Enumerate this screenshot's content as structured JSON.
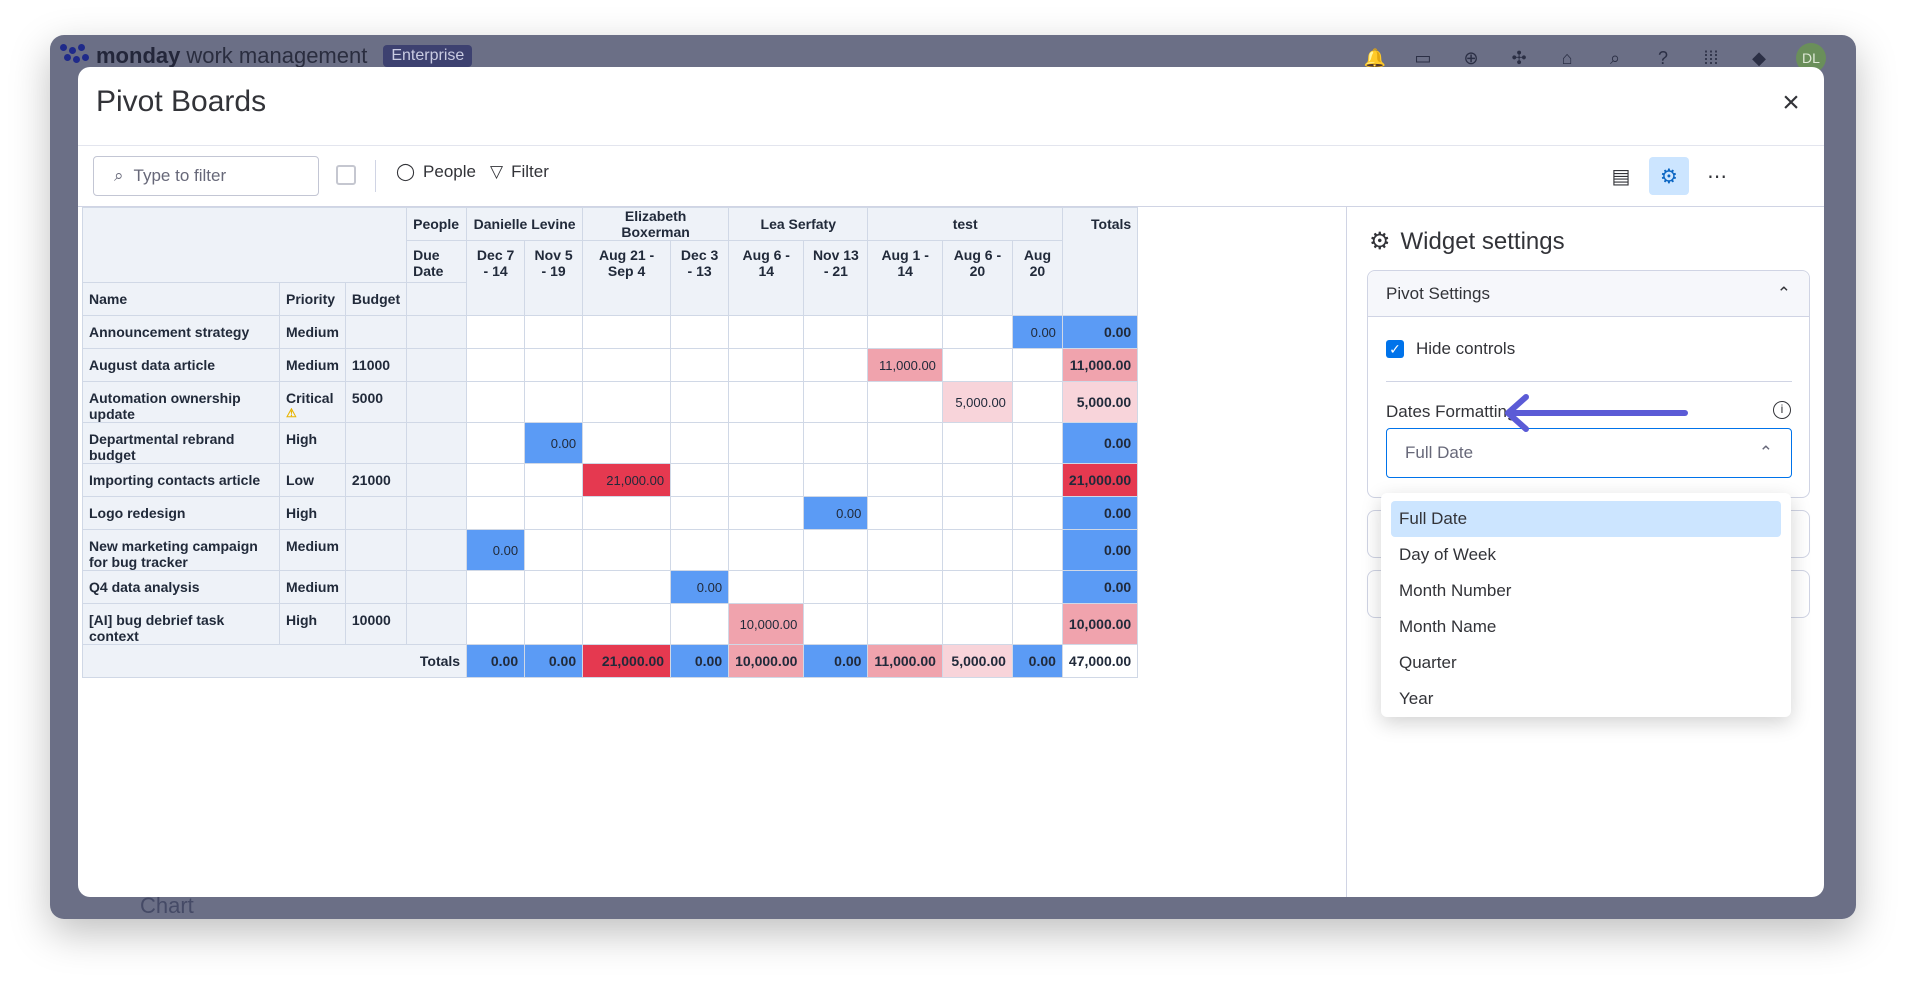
{
  "app": {
    "brand_bold": "monday",
    "brand_rest": "work management",
    "plan_badge": "Enterprise",
    "user_initials": "DL",
    "background_section_label": "Chart"
  },
  "modal": {
    "title": "Pivot Boards",
    "close_icon": "close-icon"
  },
  "toolbar": {
    "filter_placeholder": "Type to filter",
    "people_label": "People",
    "filter_label": "Filter"
  },
  "pivot": {
    "row_header_people": "People",
    "row_header_due": "Due Date",
    "col_name": "Name",
    "col_priority": "Priority",
    "col_budget": "Budget",
    "totals_label": "Totals",
    "groups": [
      {
        "name": "Danielle Levine"
      },
      {
        "name": "Elizabeth Boxerman"
      },
      {
        "name": "Lea Serfaty"
      },
      {
        "name": "test"
      }
    ],
    "date_cols": [
      "Dec 7 - 14",
      "Nov 5 - 19",
      "Aug 21 - Sep 4",
      "Dec 3 - 13",
      "Aug 6 - 14",
      "Nov 13 - 21",
      "Aug 1 - 14",
      "Aug 6 - 20",
      "Aug 20"
    ],
    "rows": [
      {
        "name": "Announcement strategy",
        "priority": "Medium",
        "budget": "",
        "cells": [
          "",
          "",
          "",
          "",
          "",
          "",
          "",
          "",
          "0.00"
        ],
        "total": "0.00"
      },
      {
        "name": "August data article",
        "priority": "Medium",
        "budget": "11000",
        "cells": [
          "",
          "",
          "",
          "",
          "",
          "",
          "11,000.00",
          "",
          ""
        ],
        "total": "11,000.00"
      },
      {
        "name": "Automation ownership update",
        "priority": "Critical",
        "priority_icon": "warning-icon",
        "budget": "5000",
        "cells": [
          "",
          "",
          "",
          "",
          "",
          "",
          "",
          "5,000.00",
          ""
        ],
        "total": "5,000.00"
      },
      {
        "name": "Departmental rebrand budget",
        "priority": "High",
        "budget": "",
        "cells": [
          "",
          "0.00",
          "",
          "",
          "",
          "",
          "",
          "",
          ""
        ],
        "total": "0.00"
      },
      {
        "name": "Importing contacts article",
        "priority": "Low",
        "budget": "21000",
        "cells": [
          "",
          "",
          "21,000.00",
          "",
          "",
          "",
          "",
          "",
          ""
        ],
        "total": "21,000.00"
      },
      {
        "name": "Logo redesign",
        "priority": "High",
        "budget": "",
        "cells": [
          "",
          "",
          "",
          "",
          "",
          "0.00",
          "",
          "",
          ""
        ],
        "total": "0.00"
      },
      {
        "name": "New marketing campaign for bug tracker",
        "priority": "Medium",
        "budget": "",
        "cells": [
          "0.00",
          "",
          "",
          "",
          "",
          "",
          "",
          "",
          ""
        ],
        "total": "0.00"
      },
      {
        "name": "Q4 data analysis",
        "priority": "Medium",
        "budget": "",
        "cells": [
          "",
          "",
          "",
          "0.00",
          "",
          "",
          "",
          "",
          ""
        ],
        "total": "0.00"
      },
      {
        "name": "[AI] bug debrief task context",
        "priority": "High",
        "budget": "10000",
        "cells": [
          "",
          "",
          "",
          "",
          "10,000.00",
          "",
          "",
          "",
          ""
        ],
        "total": "10,000.00"
      }
    ],
    "col_totals": [
      "0.00",
      "0.00",
      "21,000.00",
      "0.00",
      "10,000.00",
      "0.00",
      "11,000.00",
      "5,000.00",
      "0.00"
    ],
    "grand_total": "47,000.00",
    "colors": {
      "blue": "#5b9bf5",
      "red": "#e53950",
      "pink": "#f0a3ad",
      "light_pink": "#f8d4da"
    }
  },
  "settings": {
    "title": "Widget settings",
    "section": "Pivot Settings",
    "hide_controls_label": "Hide controls",
    "hide_controls_checked": true,
    "dates_formatting_label": "Dates Formatting",
    "select_value": "Full Date",
    "options": [
      "Full Date",
      "Day of Week",
      "Month Number",
      "Month Name",
      "Quarter",
      "Year"
    ],
    "selected_option": "Full Date",
    "accent_color": "#0073ea",
    "arrow_color": "#5b5bd6"
  }
}
